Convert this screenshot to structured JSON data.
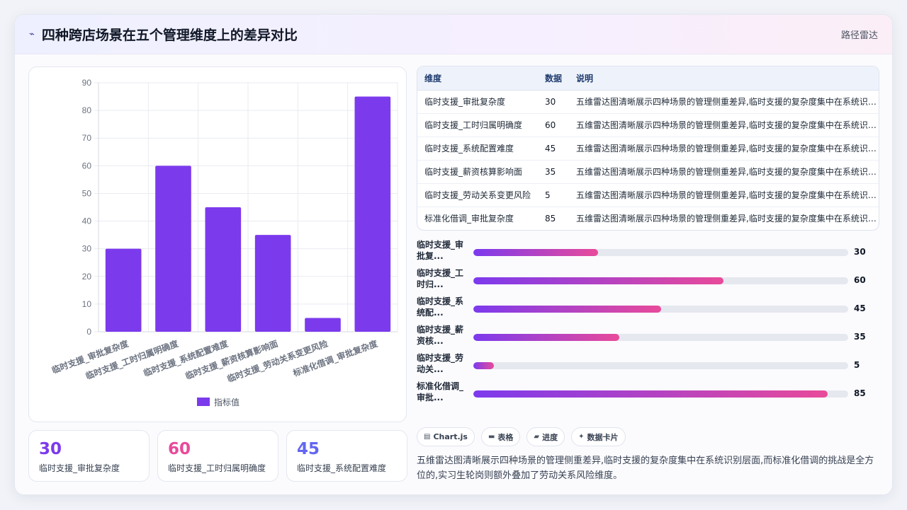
{
  "header": {
    "title": "四种跨店场景在五个管理维度上的差异对比",
    "route_label": "路径雷达"
  },
  "chart_data": {
    "type": "bar",
    "categories": [
      "临时支援_审批复杂度",
      "临时支援_工时归属明确度",
      "临时支援_系统配置难度",
      "临时支援_薪资核算影响面",
      "临时支援_劳动关系变更风险",
      "标准化借调_审批复杂度"
    ],
    "series": [
      {
        "name": "指标值",
        "values": [
          30,
          60,
          45,
          35,
          5,
          85
        ]
      }
    ],
    "ylim": [
      0,
      90
    ],
    "yticks": [
      0,
      10,
      20,
      30,
      40,
      50,
      60,
      70,
      80,
      90
    ],
    "grid": true,
    "legend": "bottom",
    "bar_color": "#7c3aed"
  },
  "table": {
    "headers": [
      "维度",
      "数据",
      "说明"
    ],
    "rows": [
      {
        "dim": "临时支援_审批复杂度",
        "value": "30",
        "desc": "五维雷达图清晰展示四种场景的管理侧重差异,临时支援的复杂度集中在系统识别层面,而标准化借调的挑战是全方位的,实习生轮岗则额外叠加了劳动关系风险维度。"
      },
      {
        "dim": "临时支援_工时归属明确度",
        "value": "60",
        "desc": "五维雷达图清晰展示四种场景的管理侧重差异,临时支援的复杂度集中在系统识别层面,而标准化借调的挑战是全方位的,实习生轮岗则额外叠加了劳动关系风险维度。"
      },
      {
        "dim": "临时支援_系统配置难度",
        "value": "45",
        "desc": "五维雷达图清晰展示四种场景的管理侧重差异,临时支援的复杂度集中在系统识别层面,而标准化借调的挑战是全方位的,实习生轮岗则额外叠加了劳动关系风险维度。"
      },
      {
        "dim": "临时支援_薪资核算影响面",
        "value": "35",
        "desc": "五维雷达图清晰展示四种场景的管理侧重差异,临时支援的复杂度集中在系统识别层面,而标准化借调的挑战是全方位的,实习生轮岗则额外叠加了劳动关系风险维度。"
      },
      {
        "dim": "临时支援_劳动关系变更风险",
        "value": "5",
        "desc": "五维雷达图清晰展示四种场景的管理侧重差异,临时支援的复杂度集中在系统识别层面,而标准化借调的挑战是全方位的,实习生轮岗则额外叠加了劳动关系风险维度。"
      },
      {
        "dim": "标准化借调_审批复杂度",
        "value": "85",
        "desc": "五维雷达图清晰展示四种场景的管理侧重差异,临时支援的复杂度集中在系统识别层面,而标准化借调的挑战是全方位的,实习生轮岗则额外叠加了劳动关系风险维度。"
      }
    ]
  },
  "progress": [
    {
      "label": "临时支援_审批复...",
      "value": 30,
      "display": "30"
    },
    {
      "label": "临时支援_工时归...",
      "value": 60,
      "display": "60"
    },
    {
      "label": "临时支援_系统配...",
      "value": 45,
      "display": "45"
    },
    {
      "label": "临时支援_薪资核...",
      "value": 35,
      "display": "35"
    },
    {
      "label": "临时支援_劳动关...",
      "value": 5,
      "display": "5"
    },
    {
      "label": "标准化借调_审批...",
      "value": 85,
      "display": "85"
    }
  ],
  "progress_max": 90,
  "stats": [
    {
      "value": "30",
      "label": "临时支援_审批复杂度",
      "color": "#7c3aed"
    },
    {
      "value": "60",
      "label": "临时支援_工时归属明确度",
      "color": "#e84a9a"
    },
    {
      "value": "45",
      "label": "临时支援_系统配置难度",
      "color": "#6366f1"
    }
  ],
  "tags": [
    {
      "icon": "▤",
      "icon_name": "chart-icon",
      "label": "Chart.js"
    },
    {
      "icon": "▬",
      "icon_name": "table-icon",
      "label": "表格"
    },
    {
      "icon": "▰",
      "icon_name": "progress-icon",
      "label": "进度"
    },
    {
      "icon": "✦",
      "icon_name": "sparkle-icon",
      "label": "数据卡片"
    }
  ],
  "summary": "五维雷达图清晰展示四种场景的管理侧重差异,临时支援的复杂度集中在系统识别层面,而标准化借调的挑战是全方位的,实习生轮岗则额外叠加了劳动关系风险维度。"
}
